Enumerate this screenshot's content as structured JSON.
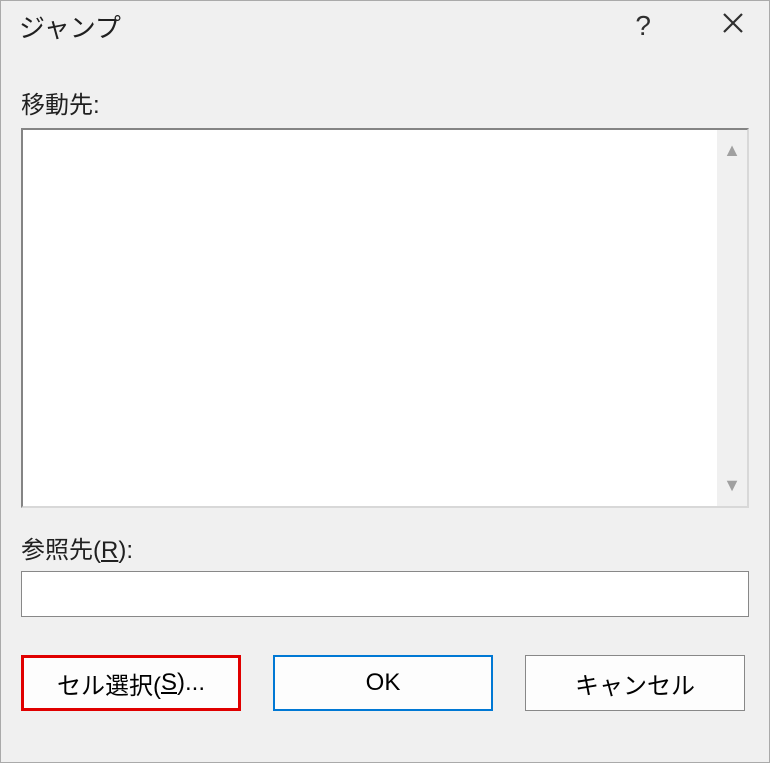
{
  "dialog": {
    "title": "ジャンプ"
  },
  "labels": {
    "goto": "移動先:",
    "reference": "参照先(R):"
  },
  "reference": {
    "value": ""
  },
  "buttons": {
    "special_prefix": "セル選択(",
    "special_key": "S",
    "special_suffix": ")...",
    "ok": "OK",
    "cancel": "キャンセル"
  }
}
